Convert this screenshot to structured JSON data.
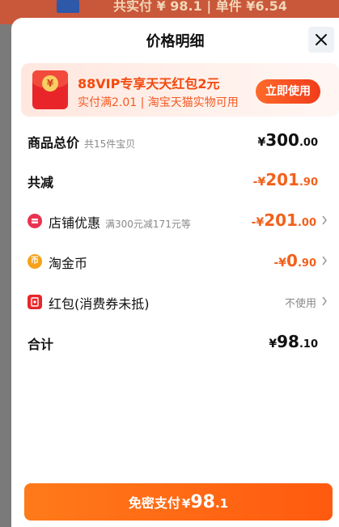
{
  "background": {
    "strip_text": "共实付 ¥ 98.1 | 单件 ¥6.54"
  },
  "header": {
    "title": "价格明细",
    "close_icon": "close-icon"
  },
  "promo": {
    "title": "88VIP专享天天红包2元",
    "subtitle": "实付满2.01 | 淘宝天猫实物可用",
    "button_label": "立即使用",
    "icon": "red-packet-icon",
    "coin_glyph": "¥"
  },
  "rows": {
    "total": {
      "label": "商品总价",
      "note": "共15件宝贝",
      "symbol": "¥",
      "int": "300",
      "dec": ".00"
    },
    "reduced": {
      "label": "共减",
      "symbol": "-¥",
      "int": "201",
      "dec": ".90"
    },
    "store": {
      "label": "店铺优惠",
      "note": "满300元减171元等",
      "symbol": "-¥",
      "int": "201",
      "dec": ".00",
      "icon": "store-coupon-icon"
    },
    "taojinbi": {
      "label": "淘金币",
      "symbol": "-¥",
      "int": "0",
      "dec": ".90",
      "icon": "taojinbi-coin-icon",
      "coin_glyph": "币"
    },
    "hongbao": {
      "label": "红包(消费券未抵)",
      "value": "不使用",
      "icon": "hongbao-icon"
    },
    "sum": {
      "label": "合计",
      "symbol": "¥",
      "int": "98",
      "dec": ".10"
    }
  },
  "pay": {
    "label": "免密支付",
    "symbol": "¥",
    "int": "98",
    "dec": ".1"
  },
  "colors": {
    "accent_orange": "#f2611c",
    "promo_red": "#f34a0d",
    "pay_button": "#ff6a14"
  }
}
